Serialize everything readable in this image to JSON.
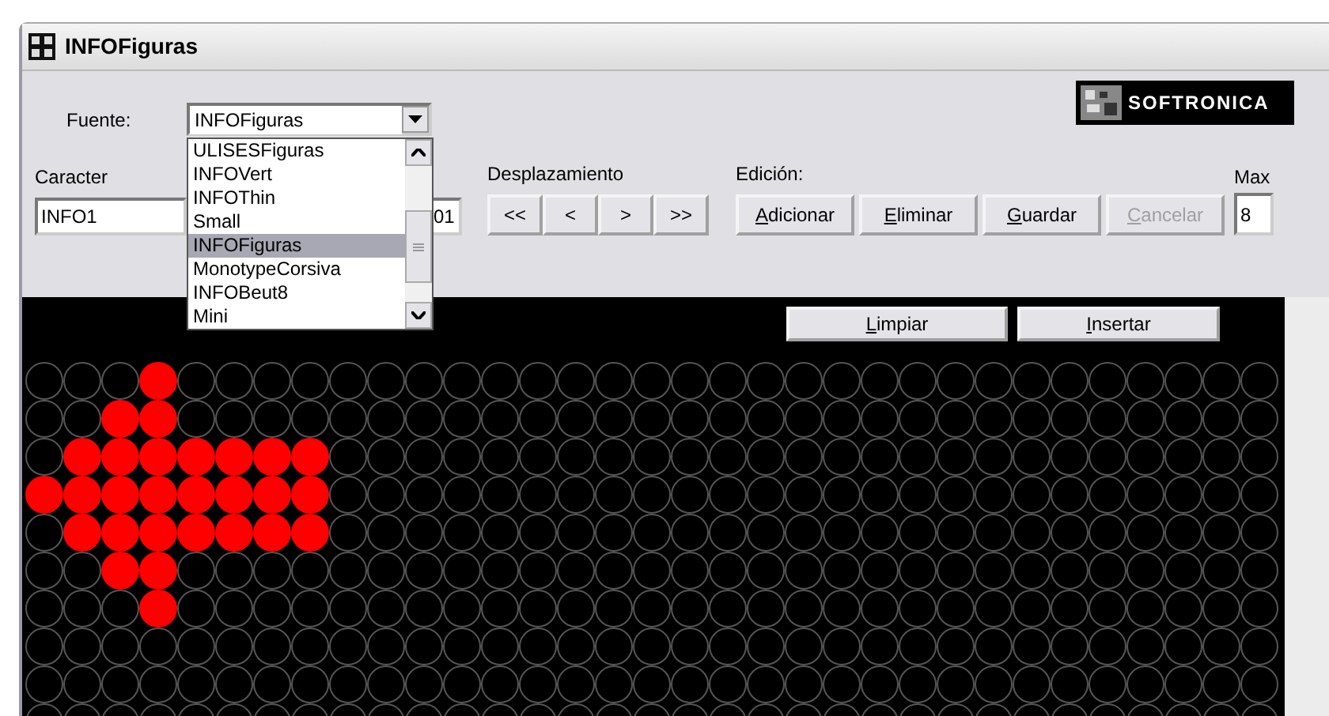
{
  "window": {
    "title": "INFOFiguras"
  },
  "logo": {
    "text": "SOFTRONICA"
  },
  "font": {
    "label": "Fuente:",
    "value": "INFOFiguras",
    "expanded": true,
    "options": [
      {
        "label": "ULISESFiguras",
        "selected": false
      },
      {
        "label": "INFOVert",
        "selected": false
      },
      {
        "label": "INFOThin",
        "selected": false
      },
      {
        "label": "Small",
        "selected": false
      },
      {
        "label": "INFOFiguras",
        "selected": true
      },
      {
        "label": "MonotypeCorsiva",
        "selected": false
      },
      {
        "label": "INFOBeut8",
        "selected": false
      },
      {
        "label": "Mini",
        "selected": false
      }
    ]
  },
  "character": {
    "label": "Caracter",
    "value": "INFO1",
    "code_value": "01"
  },
  "scroll": {
    "label": "Desplazamiento",
    "buttons": [
      "<<",
      "<",
      ">",
      ">>"
    ]
  },
  "edit": {
    "label": "Edición:",
    "buttons": [
      {
        "label": "Adicionar",
        "mnemonic": true,
        "disabled": false
      },
      {
        "label": "Eliminar",
        "mnemonic": true,
        "disabled": false
      },
      {
        "label": "Guardar",
        "mnemonic": true,
        "disabled": false
      },
      {
        "label": "Cancelar",
        "mnemonic": true,
        "disabled": true
      }
    ]
  },
  "max": {
    "label": "Max",
    "value": "8"
  },
  "canvas_buttons": [
    {
      "label": "Limpiar",
      "mnemonic": true
    },
    {
      "label": "Insertar",
      "mnemonic": true
    }
  ],
  "led_grid": {
    "rows": [
      [
        false,
        false,
        false,
        true,
        false,
        false,
        false,
        false,
        false,
        false,
        false,
        false,
        false,
        false,
        false,
        false,
        false,
        false,
        false,
        false,
        false,
        false,
        false,
        false,
        false,
        false,
        false,
        false,
        false,
        false,
        false,
        false,
        false
      ],
      [
        false,
        false,
        true,
        true,
        false,
        false,
        false,
        false,
        false,
        false,
        false,
        false,
        false,
        false,
        false,
        false,
        false,
        false,
        false,
        false,
        false,
        false,
        false,
        false,
        false,
        false,
        false,
        false,
        false,
        false,
        false,
        false,
        false
      ],
      [
        false,
        true,
        true,
        true,
        true,
        true,
        true,
        true,
        false,
        false,
        false,
        false,
        false,
        false,
        false,
        false,
        false,
        false,
        false,
        false,
        false,
        false,
        false,
        false,
        false,
        false,
        false,
        false,
        false,
        false,
        false,
        false,
        false
      ],
      [
        true,
        true,
        true,
        true,
        true,
        true,
        true,
        true,
        false,
        false,
        false,
        false,
        false,
        false,
        false,
        false,
        false,
        false,
        false,
        false,
        false,
        false,
        false,
        false,
        false,
        false,
        false,
        false,
        false,
        false,
        false,
        false,
        false
      ],
      [
        false,
        true,
        true,
        true,
        true,
        true,
        true,
        true,
        false,
        false,
        false,
        false,
        false,
        false,
        false,
        false,
        false,
        false,
        false,
        false,
        false,
        false,
        false,
        false,
        false,
        false,
        false,
        false,
        false,
        false,
        false,
        false,
        false
      ],
      [
        false,
        false,
        true,
        true,
        false,
        false,
        false,
        false,
        false,
        false,
        false,
        false,
        false,
        false,
        false,
        false,
        false,
        false,
        false,
        false,
        false,
        false,
        false,
        false,
        false,
        false,
        false,
        false,
        false,
        false,
        false,
        false,
        false
      ],
      [
        false,
        false,
        false,
        true,
        false,
        false,
        false,
        false,
        false,
        false,
        false,
        false,
        false,
        false,
        false,
        false,
        false,
        false,
        false,
        false,
        false,
        false,
        false,
        false,
        false,
        false,
        false,
        false,
        false,
        false,
        false,
        false,
        false
      ],
      [
        false,
        false,
        false,
        false,
        false,
        false,
        false,
        false,
        false,
        false,
        false,
        false,
        false,
        false,
        false,
        false,
        false,
        false,
        false,
        false,
        false,
        false,
        false,
        false,
        false,
        false,
        false,
        false,
        false,
        false,
        false,
        false,
        false
      ],
      [
        false,
        false,
        false,
        false,
        false,
        false,
        false,
        false,
        false,
        false,
        false,
        false,
        false,
        false,
        false,
        false,
        false,
        false,
        false,
        false,
        false,
        false,
        false,
        false,
        false,
        false,
        false,
        false,
        false,
        false,
        false,
        false,
        false
      ],
      [
        false,
        false,
        false,
        false,
        false,
        false,
        false,
        false,
        false,
        false,
        false,
        false,
        false,
        false,
        false,
        false,
        false,
        false,
        false,
        false,
        false,
        false,
        false,
        false,
        false,
        false,
        false,
        false,
        false,
        false,
        false,
        false,
        false
      ]
    ]
  }
}
